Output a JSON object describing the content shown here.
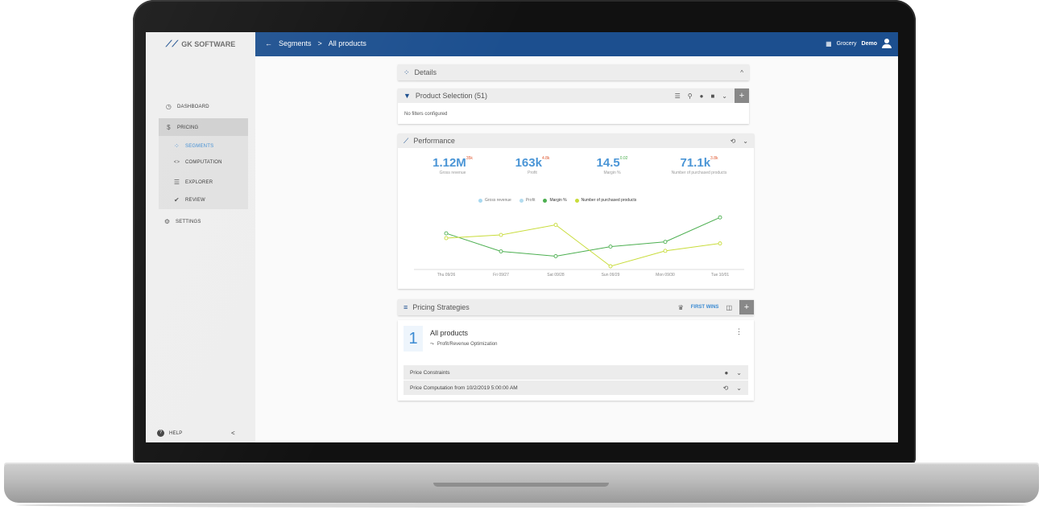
{
  "app": {
    "logo_text": "GK SOFTWARE"
  },
  "sidebar": {
    "items": [
      {
        "label": "DASHBOARD",
        "icon": "dashboard-icon",
        "glyph": "◷"
      },
      {
        "label": "PRICING",
        "icon": "dollar-icon",
        "glyph": "$"
      },
      {
        "label": "SEGMENTS",
        "icon": "segments-icon",
        "glyph": "⁘"
      },
      {
        "label": "COMPUTATION",
        "icon": "code-icon",
        "glyph": "<>"
      },
      {
        "label": "EXPLORER",
        "icon": "list-icon",
        "glyph": "☰"
      },
      {
        "label": "REVIEW",
        "icon": "check-shield-icon",
        "glyph": "✔"
      },
      {
        "label": "SETTINGS",
        "icon": "gear-icon",
        "glyph": "⚙"
      }
    ],
    "help_label": "HELP",
    "collapse_glyph": "<"
  },
  "topbar": {
    "back_glyph": "←",
    "crumb_1": "Segments",
    "crumb_sep": ">",
    "crumb_2": "All products",
    "store": "Grocery",
    "user": "Demo"
  },
  "details": {
    "title": "Details",
    "toggle": "^"
  },
  "product_selection": {
    "title": "Product Selection (51)",
    "empty": "No filters configured"
  },
  "performance": {
    "title": "Performance",
    "kpis": [
      {
        "value": "1.12M",
        "delta": "35k",
        "label": "Gross revenue"
      },
      {
        "value": "163k",
        "delta": "4.8k",
        "label": "Profit"
      },
      {
        "value": "14.5",
        "delta": "0.02",
        "label": "Margin %"
      },
      {
        "value": "71.1k",
        "delta": "3.8k",
        "label": "Number of purchased products"
      }
    ]
  },
  "chart_data": {
    "type": "line",
    "categories": [
      "Thu 09/26",
      "Fri 09/27",
      "Sat 09/28",
      "Sun 09/29",
      "Mon 09/30",
      "Tue 10/01"
    ],
    "legend": [
      "Gross revenue",
      "Profit",
      "Margin %",
      "Number of purchased products"
    ],
    "series": [
      {
        "name": "Margin %",
        "values": [
          0.62,
          0.28,
          0.19,
          0.37,
          0.46,
          0.92
        ]
      },
      {
        "name": "Number of purchased products",
        "values": [
          0.53,
          0.59,
          0.78,
          0.0,
          0.29,
          0.43
        ]
      }
    ],
    "colors": {
      "Gross revenue": "#a8d8f0",
      "Profit": "#b3dcef",
      "Margin %": "#4caf50",
      "Number of purchased products": "#c8dc3a"
    }
  },
  "strategies": {
    "title": "Pricing Strategies",
    "first_wins": "FIRST WINS",
    "item": {
      "number": "1",
      "name": "All products",
      "subtitle": "Profit/Revenue Optimization",
      "rows": [
        "Price Constraints",
        "Price Computation from 10/2/2019 5:00:00 AM"
      ]
    }
  }
}
